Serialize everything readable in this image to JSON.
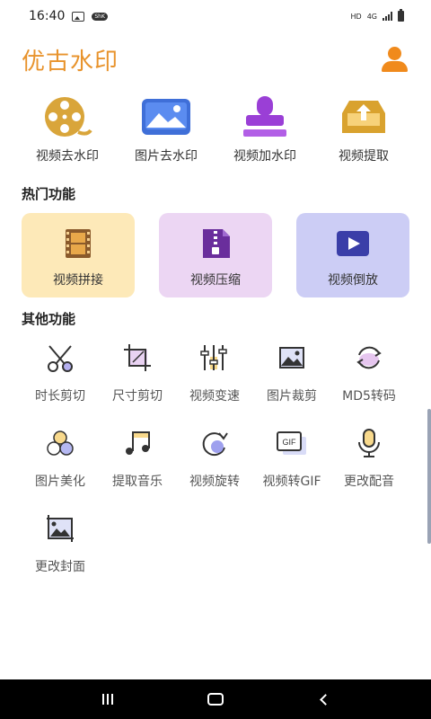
{
  "status_bar": {
    "time": "16:40",
    "pill": "ShK",
    "hd": "HD",
    "net": "4G"
  },
  "header": {
    "title": "优古水印"
  },
  "top_tools": [
    {
      "label": "视频去水印",
      "icon": "film-reel-icon"
    },
    {
      "label": "图片去水印",
      "icon": "image-icon"
    },
    {
      "label": "视频加水印",
      "icon": "stamp-icon"
    },
    {
      "label": "视频提取",
      "icon": "tray-upload-icon"
    }
  ],
  "hot": {
    "title": "热门功能",
    "items": [
      {
        "label": "视频拼接",
        "icon": "film-strip-icon",
        "bg": "#fde9b8"
      },
      {
        "label": "视频压缩",
        "icon": "zip-file-icon",
        "bg": "#ecd6f3"
      },
      {
        "label": "视频倒放",
        "icon": "play-screen-icon",
        "bg": "#cccdf5"
      }
    ]
  },
  "other": {
    "title": "其他功能",
    "items": [
      {
        "label": "时长剪切",
        "icon": "scissors-icon"
      },
      {
        "label": "尺寸剪切",
        "icon": "crop-icon"
      },
      {
        "label": "视频变速",
        "icon": "sliders-icon"
      },
      {
        "label": "图片裁剪",
        "icon": "picture-crop-icon"
      },
      {
        "label": "MD5转码",
        "icon": "refresh-icon"
      },
      {
        "label": "图片美化",
        "icon": "circles-icon"
      },
      {
        "label": "提取音乐",
        "icon": "music-note-icon"
      },
      {
        "label": "视频旋转",
        "icon": "rotate-icon"
      },
      {
        "label": "视频转GIF",
        "icon": "gif-icon"
      },
      {
        "label": "更改配音",
        "icon": "microphone-icon"
      },
      {
        "label": "更改封面",
        "icon": "cover-image-icon"
      }
    ]
  },
  "gif_text": "GIF",
  "colors": {
    "accent": "#e8932c",
    "user": "#f08a1c"
  }
}
